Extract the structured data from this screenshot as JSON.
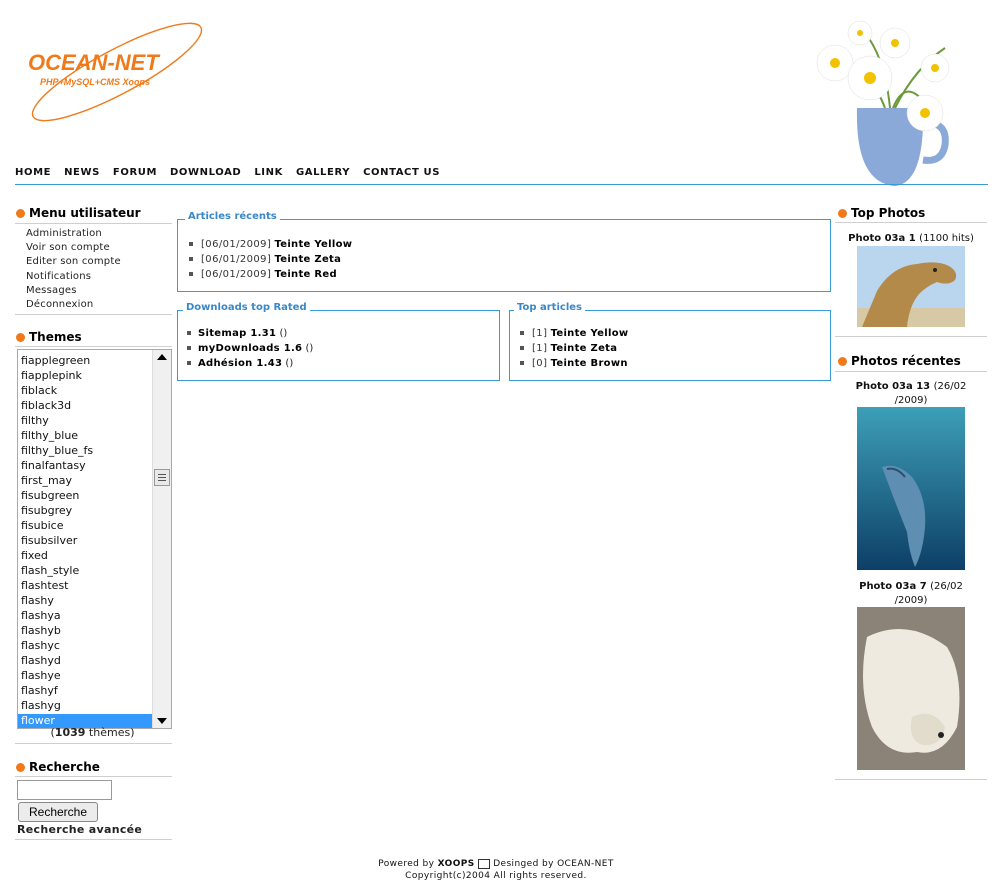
{
  "brand": {
    "logo_text": "OCEAN-NET",
    "logo_sub": "PHP+MySQL+CMS Xoops",
    "accent": "#f07a1a",
    "line_color": "#3a9ad6"
  },
  "nav": [
    "HOME",
    "NEWS",
    "FORUM",
    "DOWNLOAD",
    "LINK",
    "GALLERY",
    "CONTACT US"
  ],
  "user_menu": {
    "title": "Menu utilisateur",
    "items": [
      "Administration",
      "Voir son compte",
      "Editer son compte",
      "Notifications",
      "Messages",
      "Déconnexion"
    ]
  },
  "themes": {
    "title": "Themes",
    "options": [
      "fiapplegreen",
      "fiapplepink",
      "fiblack",
      "fiblack3d",
      "filthy",
      "filthy_blue",
      "filthy_blue_fs",
      "finalfantasy",
      "first_may",
      "fisubgreen",
      "fisubgrey",
      "fisubice",
      "fisubsilver",
      "fixed",
      "flash_style",
      "flashtest",
      "flashy",
      "flashya",
      "flashyb",
      "flashyc",
      "flashyd",
      "flashye",
      "flashyf",
      "flashyg",
      "flower"
    ],
    "selected": "flower",
    "count": "1039",
    "count_suffix": "thèmes"
  },
  "search": {
    "title": "Recherche",
    "input_value": "",
    "button_label": "Recherche",
    "advanced_label": "Recherche avancée"
  },
  "articles_recent": {
    "legend": "Articles récents",
    "items": [
      {
        "date": "[06/01/2009]",
        "title": "Teinte Yellow"
      },
      {
        "date": "[06/01/2009]",
        "title": "Teinte Zeta"
      },
      {
        "date": "[06/01/2009]",
        "title": "Teinte Red"
      }
    ]
  },
  "downloads_top": {
    "legend": "Downloads top Rated",
    "items": [
      {
        "title": "Sitemap 1.31",
        "extra": "()"
      },
      {
        "title": "myDownloads 1.6",
        "extra": "()"
      },
      {
        "title": "Adhésion 1.43",
        "extra": "()"
      }
    ]
  },
  "top_articles": {
    "legend": "Top articles",
    "items": [
      {
        "count": "[1]",
        "title": "Teinte Yellow"
      },
      {
        "count": "[1]",
        "title": "Teinte Zeta"
      },
      {
        "count": "[0]",
        "title": "Teinte Brown"
      }
    ]
  },
  "top_photos": {
    "title": "Top Photos",
    "photo": {
      "name": "Photo 03a 1",
      "meta": "(1100 hits)",
      "icon": "camel-photo"
    }
  },
  "recent_photos": {
    "title": "Photos récentes",
    "photos": [
      {
        "name": "Photo 03a 13",
        "meta": "(26/02",
        "meta2": "/2009)",
        "icon": "dolphin-photo"
      },
      {
        "name": "Photo 03a 7",
        "meta": "(26/02",
        "meta2": "/2009)",
        "icon": "polar-bear-photo"
      }
    ]
  },
  "footer": {
    "powered_prefix": "Powered by",
    "powered_name": "XOOPS",
    "designed": "Desinged by OCEAN-NET",
    "copyright": "Copyright(c)2004 All rights reserved."
  }
}
